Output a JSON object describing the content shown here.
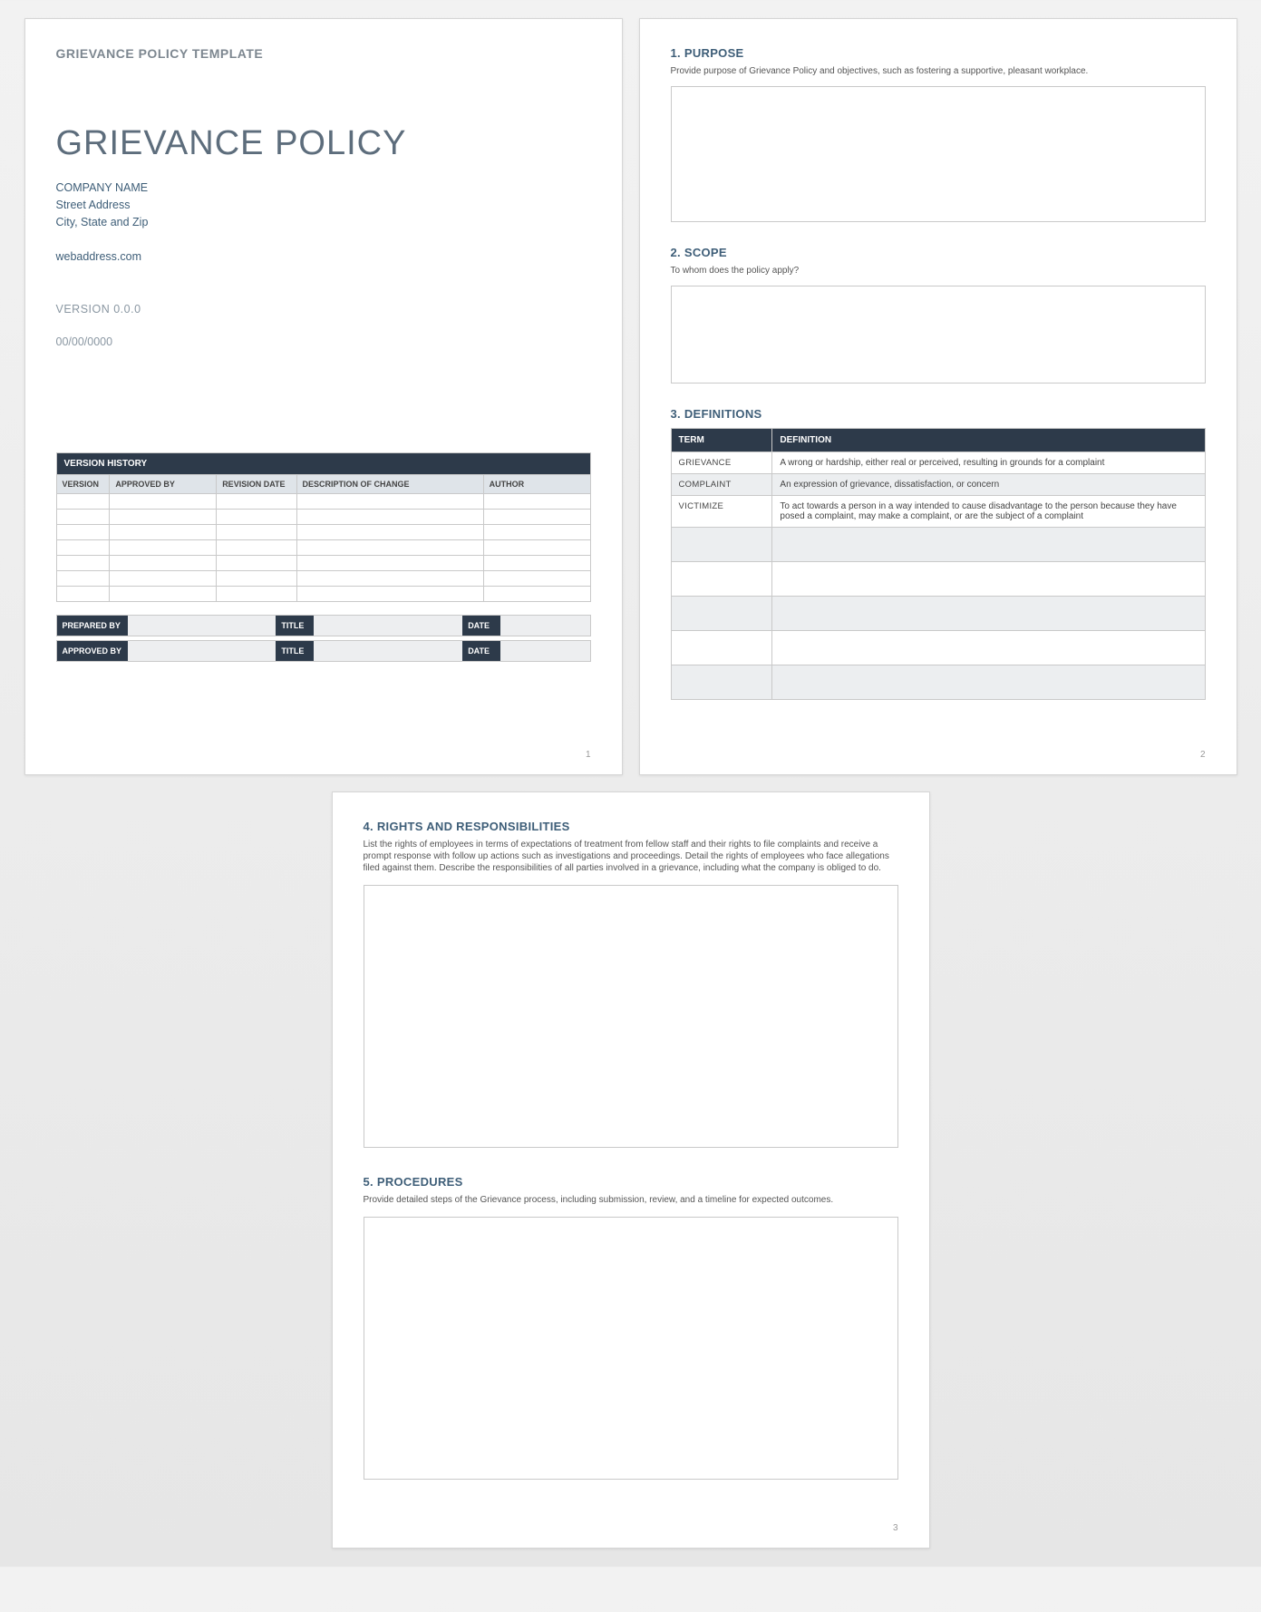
{
  "page1": {
    "eyebrow": "GRIEVANCE POLICY TEMPLATE",
    "title": "GRIEVANCE POLICY",
    "company_name": "COMPANY NAME",
    "street": "Street Address",
    "city_state_zip": "City, State and Zip",
    "web": "webaddress.com",
    "version": "VERSION 0.0.0",
    "date": "00/00/0000",
    "version_history_title": "VERSION HISTORY",
    "vh_headers": {
      "version": "VERSION",
      "approved_by": "APPROVED BY",
      "revision_date": "REVISION DATE",
      "description": "DESCRIPTION OF CHANGE",
      "author": "AUTHOR"
    },
    "sig": {
      "prepared_by": "PREPARED BY",
      "approved_by": "APPROVED BY",
      "title": "TITLE",
      "date": "DATE"
    },
    "page_num": "1"
  },
  "page2": {
    "purpose_head": "1.  PURPOSE",
    "purpose_desc": "Provide purpose of Grievance Policy and objectives, such as fostering a supportive, pleasant workplace.",
    "scope_head": "2.  SCOPE",
    "scope_desc": "To whom does the policy apply?",
    "def_head": "3.  DEFINITIONS",
    "def_th_term": "TERM",
    "def_th_def": "DEFINITION",
    "defs": [
      {
        "term": "GRIEVANCE",
        "def": "A wrong or hardship, either real or perceived, resulting in grounds for a complaint"
      },
      {
        "term": "COMPLAINT",
        "def": "An expression of grievance, dissatisfaction, or concern"
      },
      {
        "term": "VICTIMIZE",
        "def": "To act towards a person in a way intended to cause disadvantage to the person because they have posed a complaint, may make a complaint, or are the subject of a complaint"
      }
    ],
    "page_num": "2"
  },
  "page3": {
    "rights_head": "4.  RIGHTS AND RESPONSIBILITIES",
    "rights_desc": "List the rights of employees in terms of expectations of treatment from fellow staff and their rights to file complaints and receive a prompt response with follow up actions such as investigations and proceedings.  Detail the rights of employees who face allegations filed against them.  Describe the responsibilities of all parties involved in a grievance, including what the company is obliged to do.",
    "proc_head": "5.  PROCEDURES",
    "proc_desc": "Provide detailed steps of the Grievance process, including submission, review, and a timeline for expected outcomes.",
    "page_num": "3"
  }
}
